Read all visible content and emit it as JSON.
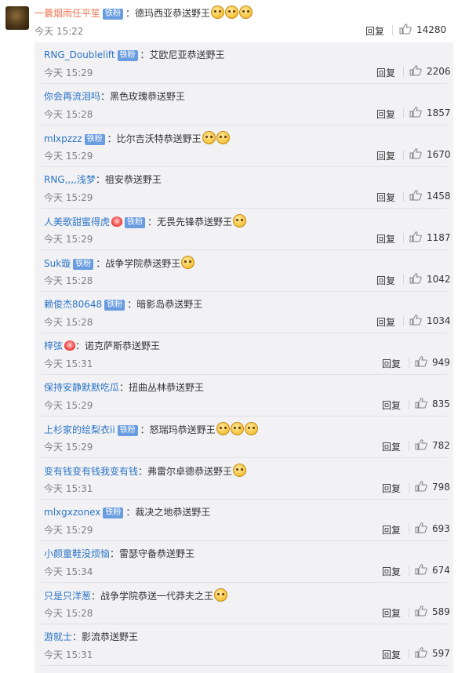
{
  "main_comment": {
    "username": "一蓑烟雨任平笙",
    "badge": "铁粉",
    "text": "：德玛西亚恭送野王",
    "emojis": [
      "laugh-cry-icon",
      "laugh-cry-icon",
      "cry-icon"
    ],
    "time": "今天 15:22",
    "reply_label": "回复",
    "likes": "14280"
  },
  "replies": [
    {
      "username": "RNG_Doublelift",
      "badge": "铁粉",
      "text": "：艾欧尼亚恭送野王",
      "emojis": [],
      "time": "今天 15:29",
      "reply_label": "回复",
      "likes": "2206"
    },
    {
      "username": "你会再流泪吗",
      "badge": "",
      "text": "：黑色玫瑰恭送野王",
      "emojis": [],
      "time": "今天 15:28",
      "reply_label": "回复",
      "likes": "1857"
    },
    {
      "username": "mlxpzzz",
      "badge": "铁粉",
      "text": "：比尔吉沃特恭送野王",
      "emojis": [
        "cry-icon",
        "cry-icon"
      ],
      "time": "今天 15:29",
      "reply_label": "回复",
      "likes": "1670"
    },
    {
      "username": "RNG,,,,浅梦",
      "badge": "",
      "text": "：祖安恭送野王",
      "emojis": [],
      "time": "今天 15:29",
      "reply_label": "回复",
      "likes": "1458"
    },
    {
      "username": "人美歌甜蜜得虎",
      "badge": "铁粉",
      "heart": true,
      "text": "：无畏先锋恭送野王",
      "emojis": [
        "pleading-icon"
      ],
      "time": "今天 15:29",
      "reply_label": "回复",
      "likes": "1187"
    },
    {
      "username": "Suk璇",
      "badge": "铁粉",
      "text": "：战争学院恭送野王",
      "emojis": [
        "sob-icon"
      ],
      "time": "今天 15:28",
      "reply_label": "回复",
      "likes": "1042"
    },
    {
      "username": "赖俊杰80648",
      "badge": "铁粉",
      "text": "：暗影岛恭送野王",
      "emojis": [],
      "time": "今天 15:28",
      "reply_label": "回复",
      "likes": "1034"
    },
    {
      "username": "梓弦",
      "badge": "",
      "heart": true,
      "text": "：诺克萨斯恭送野王",
      "emojis": [],
      "time": "今天 15:31",
      "reply_label": "回复",
      "likes": "949"
    },
    {
      "username": "保持安静默默吃瓜",
      "badge": "",
      "text": "：扭曲丛林恭送野王",
      "emojis": [],
      "time": "今天 15:29",
      "reply_label": "回复",
      "likes": "835"
    },
    {
      "username": "上杉家的绘梨衣ii",
      "badge": "铁粉",
      "text": "：怒瑞玛恭送野王",
      "emojis": [
        "cry-icon",
        "cry-icon",
        "cry-icon"
      ],
      "time": "今天 15:29",
      "reply_label": "回复",
      "likes": "782"
    },
    {
      "username": "变有钱变有钱我变有钱",
      "badge": "",
      "text": "：弗雷尔卓德恭送野王",
      "emojis": [
        "cry-icon"
      ],
      "time": "今天 15:31",
      "reply_label": "回复",
      "likes": "798"
    },
    {
      "username": "mlxgxzonex",
      "badge": "铁粉",
      "text": "：裁决之地恭送野王",
      "emojis": [],
      "time": "今天 15:29",
      "reply_label": "回复",
      "likes": "693"
    },
    {
      "username": "小颜童鞋没烦恼",
      "badge": "",
      "text": "：雷瑟守备恭送野王",
      "emojis": [],
      "time": "今天 15:34",
      "reply_label": "回复",
      "likes": "674"
    },
    {
      "username": "只是只洋葱",
      "badge": "",
      "text": "：战争学院恭送一代莽夫之王",
      "emojis": [
        "cry-icon"
      ],
      "time": "今天 15:28",
      "reply_label": "回复",
      "likes": "589"
    },
    {
      "username": "游就士",
      "badge": "",
      "text": "：影流恭送野王",
      "emojis": [],
      "time": "今天 15:31",
      "reply_label": "回复",
      "likes": "597"
    }
  ]
}
